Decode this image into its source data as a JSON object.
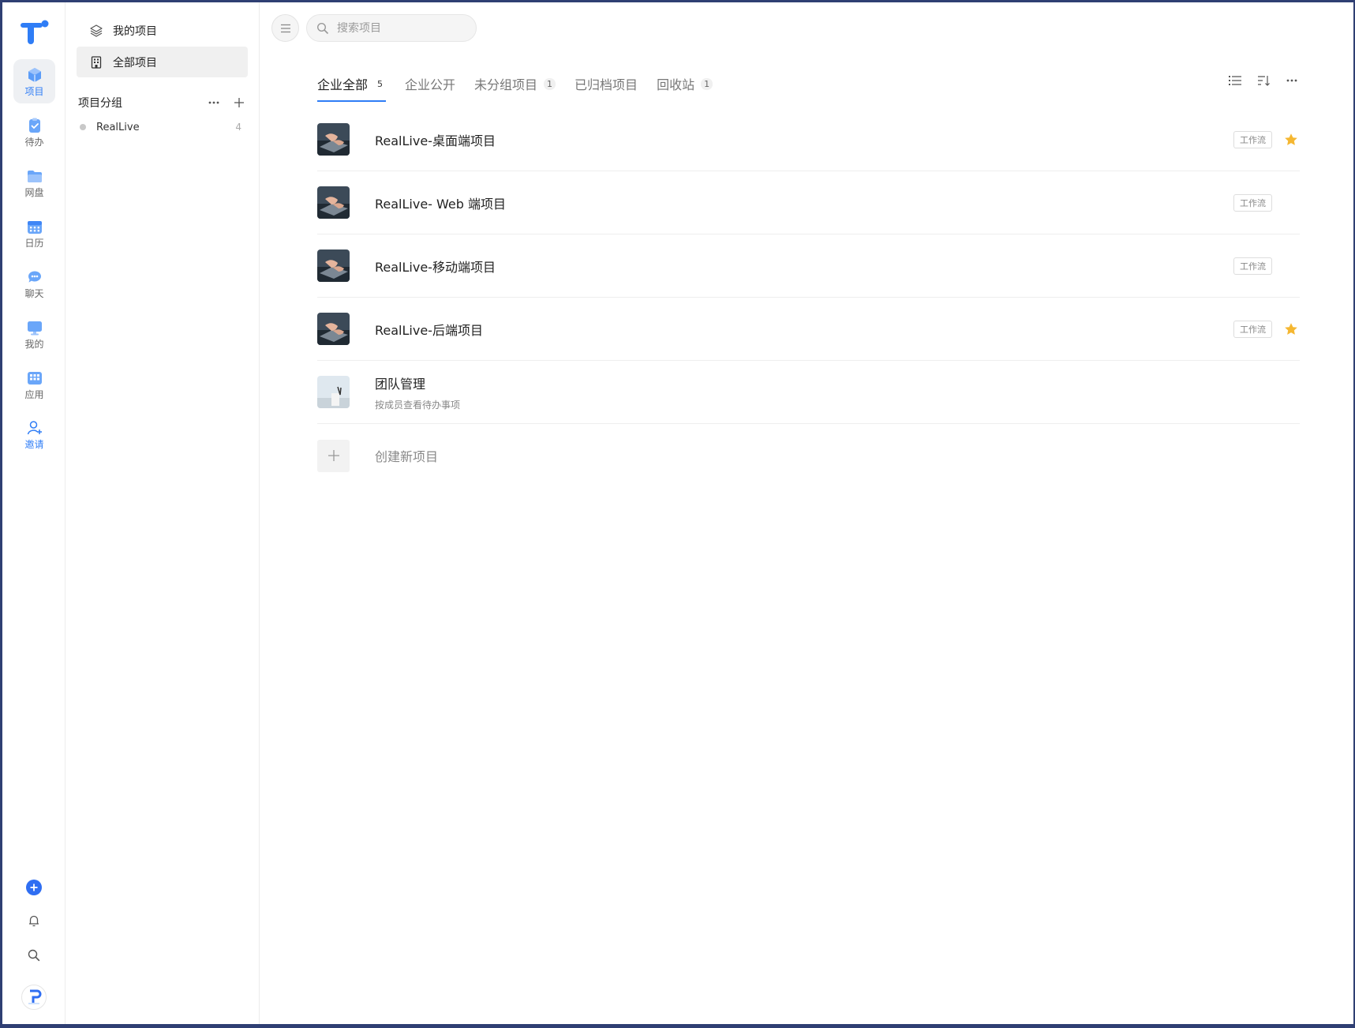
{
  "rail": {
    "items": [
      {
        "label": "项目",
        "icon": "project-cube-icon",
        "active": true
      },
      {
        "label": "待办",
        "icon": "todo-clipboard-icon"
      },
      {
        "label": "网盘",
        "icon": "drive-folder-icon"
      },
      {
        "label": "日历",
        "icon": "calendar-icon"
      },
      {
        "label": "聊天",
        "icon": "chat-bubble-icon"
      },
      {
        "label": "我的",
        "icon": "monitor-icon"
      },
      {
        "label": "应用",
        "icon": "apps-grid-icon"
      },
      {
        "label": "邀请",
        "icon": "invite-user-icon"
      }
    ]
  },
  "sidebar": {
    "nav": [
      {
        "label": "我的项目",
        "icon": "layers-icon"
      },
      {
        "label": "全部项目",
        "icon": "building-icon",
        "active": true
      }
    ],
    "group_title": "项目分组",
    "groups": [
      {
        "name": "RealLive",
        "count": "4"
      }
    ]
  },
  "search": {
    "placeholder": "搜索项目"
  },
  "tabs": [
    {
      "label": "企业全部",
      "badge": "5",
      "active": true
    },
    {
      "label": "企业公开",
      "badge": ""
    },
    {
      "label": "未分组项目",
      "badge": "1"
    },
    {
      "label": "已归档项目",
      "badge": ""
    },
    {
      "label": "回收站",
      "badge": "1"
    }
  ],
  "projects": [
    {
      "name": "RealLive-桌面端项目",
      "tag": "工作流",
      "starred": true
    },
    {
      "name": "RealLive- Web 端项目",
      "tag": "工作流",
      "starred": false
    },
    {
      "name": "RealLive-移动端项目",
      "tag": "工作流",
      "starred": false
    },
    {
      "name": "RealLive-后端项目",
      "tag": "工作流",
      "starred": true
    },
    {
      "name": "团队管理",
      "desc": "按成员查看待办事项"
    }
  ],
  "create_label": "创建新项目",
  "colors": {
    "accent": "#2f7df6",
    "star": "#f5b731",
    "border": "#2f3f73"
  }
}
